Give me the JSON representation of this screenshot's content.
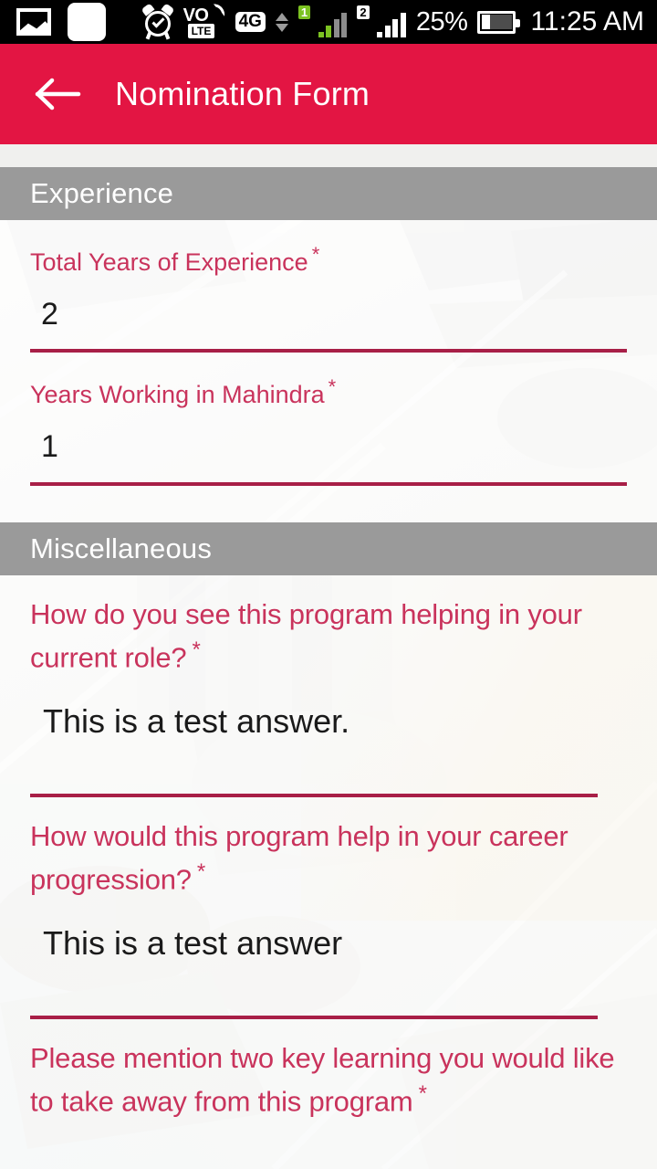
{
  "statusbar": {
    "icons_left": [
      "photo-icon",
      "blank-app-icon"
    ],
    "icons_center": [
      "alarm-icon",
      "volte-icon",
      "4g-icon",
      "data-transfer-icon",
      "sim1-signal-icon",
      "sim2-signal-icon"
    ],
    "volte_primary": "VO",
    "volte_secondary": "LTE",
    "network_type": "4G",
    "sim1_badge": "1",
    "sim2_badge": "2",
    "battery_percent": "25%",
    "time": "11:25 AM"
  },
  "appbar": {
    "back_icon": "arrow-left-icon",
    "title": "Nomination Form",
    "color": "#E31543"
  },
  "theme": {
    "accent": "#E31543",
    "label_pink": "#C9335C",
    "underline": "#A81F47",
    "section_gray": "#9A9A9A",
    "value_black": "#1A1A1A"
  },
  "sections": [
    {
      "title": "Experience",
      "fields": [
        {
          "label": "Total Years of Experience",
          "required": "*",
          "value": "2",
          "placeholder": ""
        },
        {
          "label": "Years Working in Mahindra",
          "required": "*",
          "value": "1",
          "placeholder": ""
        }
      ]
    },
    {
      "title": "Miscellaneous",
      "questions": [
        {
          "label": "How do you see this program helping in your current role?",
          "required": "*",
          "value": "This is a test answer.",
          "placeholder": ""
        },
        {
          "label": "How would this program help in your career progression?",
          "required": "*",
          "value": "This is a test answer",
          "placeholder": ""
        },
        {
          "label": "Please mention two key learning you would like to take away from this program",
          "required": "*",
          "value": "",
          "placeholder": ""
        }
      ]
    }
  ]
}
